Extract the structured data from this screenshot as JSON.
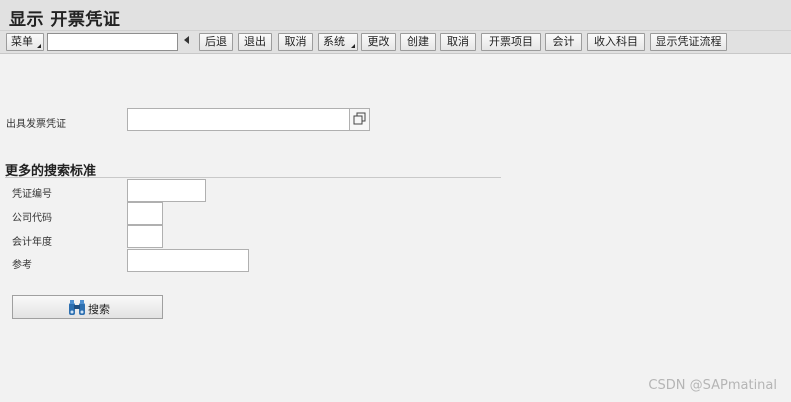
{
  "window": {
    "title": "显示 开票凭证"
  },
  "toolbar": {
    "menu_label": "菜单",
    "command_value": "",
    "buttons": [
      "后退",
      "退出",
      "取消",
      "系统",
      "更改",
      "创建",
      "取消",
      "开票项目",
      "会计",
      "收入科目",
      "显示凭证流程"
    ]
  },
  "form": {
    "billing_doc_label": "出具发票凭证",
    "billing_doc_value": ""
  },
  "more_criteria": {
    "title": "更多的搜索标准",
    "doc_number_label": "凭证编号",
    "company_code_label": "公司代码",
    "fiscal_year_label": "会计年度",
    "reference_label": "参考"
  },
  "search_button_label": "搜索",
  "watermark": "CSDN @SAPmatinal",
  "colors": {
    "background": "#f2f2f2",
    "toolbar": "#e1e1e1",
    "binocular_icon": "#2d6fb0"
  }
}
